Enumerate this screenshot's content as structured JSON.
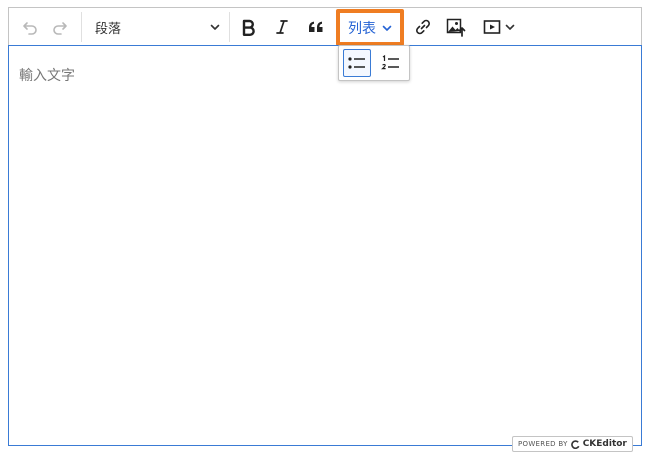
{
  "toolbar": {
    "heading": {
      "label": "段落"
    },
    "list_dropdown": {
      "label": "列表"
    }
  },
  "editor": {
    "placeholder": "輸入文字"
  },
  "list_panel": {
    "items": [
      "bulleted-list",
      "numbered-list"
    ]
  },
  "powered_by": {
    "prefix": "POWERED BY",
    "brand": "CKEditor"
  },
  "colors": {
    "accent": "#2563d4",
    "highlight_border": "#ef7d22",
    "focus_border": "#3a7bd5"
  }
}
